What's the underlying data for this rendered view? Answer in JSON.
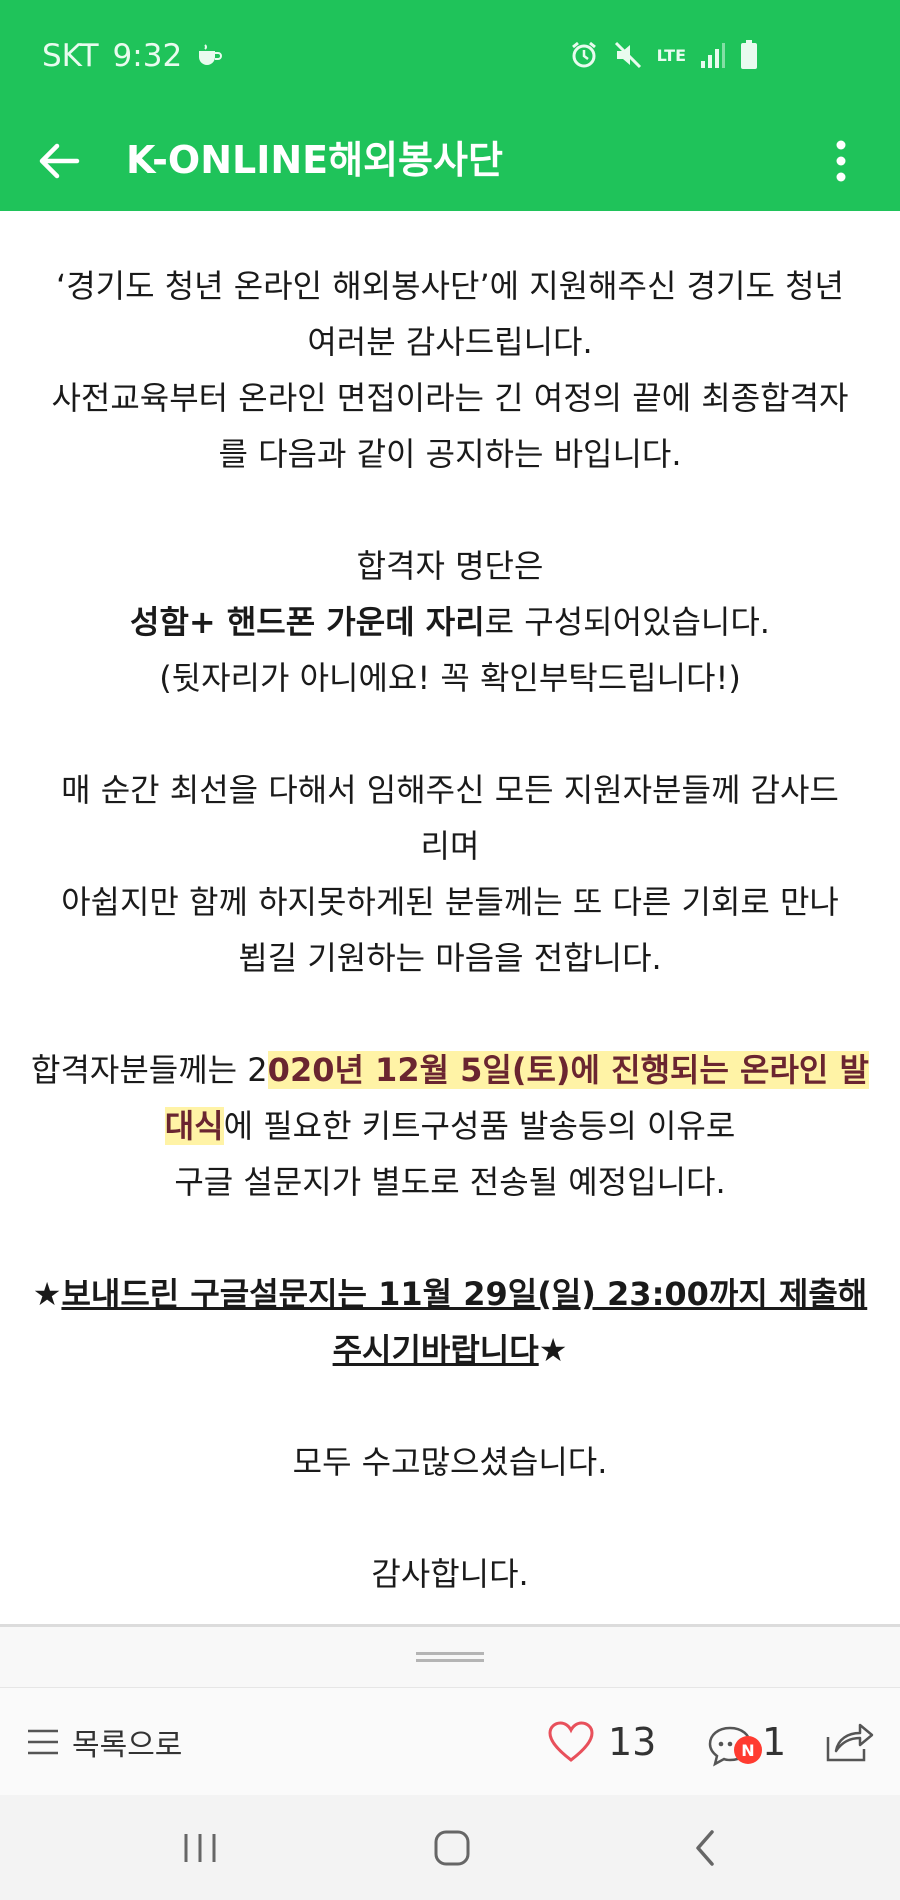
{
  "status": {
    "carrier": "SKT",
    "time": "9:32",
    "network": "LTE"
  },
  "header": {
    "title": "K-ONLINE해외봉사단"
  },
  "post": {
    "p1_l1": "‘경기도 청년 온라인 해외봉사단’에 지원해주신 경기도 청년",
    "p1_l2": "여러분 감사드립니다.",
    "p1_l3": "사전교육부터 온라인 면접이라는 긴 여정의 끝에 최종합격자",
    "p1_l4": "를 다음과 같이 공지하는 바입니다.",
    "p2_l1": "합격자 명단은",
    "p2_l2_bold": "성함+ 핸드폰 가운데 자리",
    "p2_l2_rest": "로 구성되어있습니다.",
    "p2_l3": "(뒷자리가 아니에요! 꼭 확인부탁드립니다!)",
    "p3_l1": "매 순간 최선을 다해서 임해주신 모든 지원자분들께 감사드",
    "p3_l2": "리며",
    "p3_l3": "아쉽지만 함께 하지못하게된 분들께는 또 다른 기회로 만나",
    "p3_l4": "뵙길 기원하는 마음을 전합니다.",
    "p4_l1_pre": "합격자분들께는 2",
    "p4_l1_hl": "020년 12월 5일(토)에 진행되는 온라인 발",
    "p4_l2_hl": "대식",
    "p4_l2_rest": "에 필요한 키트구성품 발송등의 이유로",
    "p4_l3": "구글 설문지가 별도로 전송될 예정입니다.",
    "p5_star_left": "★",
    "p5_l1_ul": "보내드린 구글설문지는 11월 29일(일) 23:00까지 제출해",
    "p5_l2_ul": "주시기바랍니다",
    "p5_star_right": "★",
    "p6": "모두 수고많으셨습니다.",
    "p7": "감사합니다."
  },
  "bottombar": {
    "list_label": "목록으로",
    "likes": "13",
    "comments": "1",
    "comment_badge": "N"
  },
  "colors": {
    "brand_green": "#1fc35a",
    "highlight": "#fff3a6",
    "highlight_text": "#6a2530",
    "like_red": "#e8505b"
  },
  "icons": [
    "back-arrow-icon",
    "more-vert-icon",
    "alarm-icon",
    "mute-icon",
    "signal-icon",
    "battery-icon",
    "list-icon",
    "heart-icon",
    "comment-icon",
    "share-icon",
    "recents-icon",
    "home-icon",
    "nav-back-icon"
  ]
}
